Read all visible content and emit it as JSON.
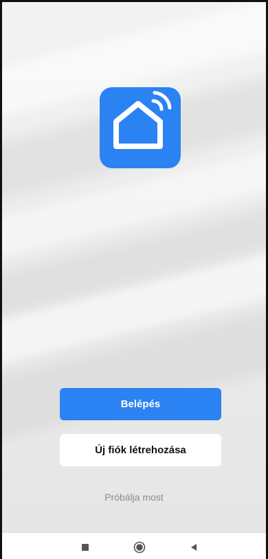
{
  "app": {
    "logo_icon": "smart-home-wifi-icon",
    "brand_color": "#2b82f2"
  },
  "actions": {
    "login_label": "Belépés",
    "register_label": "Új fiók létrehozása",
    "try_label": "Próbálja most"
  },
  "navigation_bar": {
    "recent_icon": "square-recent-apps-icon",
    "home_icon": "circle-home-icon",
    "back_icon": "triangle-back-icon"
  }
}
